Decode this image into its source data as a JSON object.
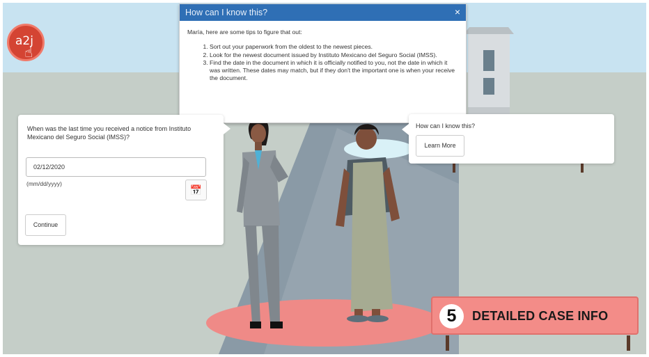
{
  "logo": {
    "text": "a2j",
    "icon": "pointer-hand-icon"
  },
  "popup": {
    "title": "How can I know this?",
    "close": "×",
    "intro": "María, here are some tips to figure that out:",
    "tips": [
      "Sort out your paperwork from the oldest to the newest pieces.",
      "Look for the newest document issued by Instituto Mexicano del Seguro Social (IMSS).",
      "Find the date in the document in which it is officially notified to you, not the date in which it was written. These dates may match, but if they don't the important one is when your receive the document."
    ]
  },
  "question": {
    "text": "When was the last time you received a notice from Instituto Mexicano del Seguro Social (IMSS)?",
    "date_value": "02/12/2020",
    "hint": "(mm/dd/yyyy)",
    "calendar_icon": "calendar-icon",
    "continue_label": "Continue"
  },
  "help": {
    "text": "How can I know this?",
    "learn_label": "Learn More"
  },
  "step": {
    "number": "5",
    "label": "DETAILED CASE INFO"
  },
  "colors": {
    "sky": "#c8e3f1",
    "ground": "#c5cec8",
    "road": "#8a9aa6",
    "spotlight": "#ef8a87",
    "header": "#2f6fb5",
    "logo": "#d44433"
  }
}
